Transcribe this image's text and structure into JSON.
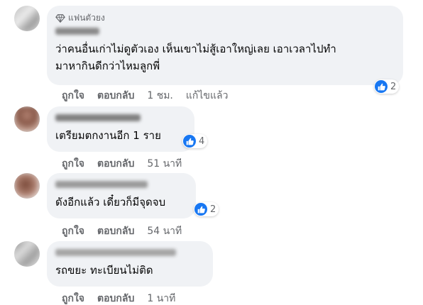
{
  "comments": [
    {
      "badge": "แฟนตัวยง",
      "text_lines": [
        "ว่าคนอื่นเก่าไม่ดูตัวเอง เห็นเขาไม่สู้เอาใหญ่เลย เอาเวลาไปทำ",
        "มาหากินดีกว่าไหมลูกพี่"
      ],
      "reaction_count": "2",
      "like_label": "ถูกใจ",
      "reply_label": "ตอบกลับ",
      "time": "1 ชม.",
      "edited": "แก้ไขแล้ว"
    },
    {
      "text_lines": [
        "เตรียมตกงานอีก 1 ราย"
      ],
      "reaction_count": "4",
      "like_label": "ถูกใจ",
      "reply_label": "ตอบกลับ",
      "time": "51 นาที"
    },
    {
      "text_lines": [
        "ดังอีกแล้ว เดี๋ยวก็มีจุดจบ"
      ],
      "reaction_count": "2",
      "like_label": "ถูกใจ",
      "reply_label": "ตอบกลับ",
      "time": "54 นาที"
    },
    {
      "text_lines": [
        "รถขยะ ทะเบียนไม่ติด"
      ],
      "like_label": "ถูกใจ",
      "reply_label": "ตอบกลับ",
      "time": "1 นาที"
    }
  ],
  "colors": {
    "bubble": "#f0f2f5",
    "meta_text": "#65676b",
    "like_blue": "#1877f2"
  },
  "icons": [
    "diamond-badge-icon",
    "like-reaction-icon"
  ]
}
